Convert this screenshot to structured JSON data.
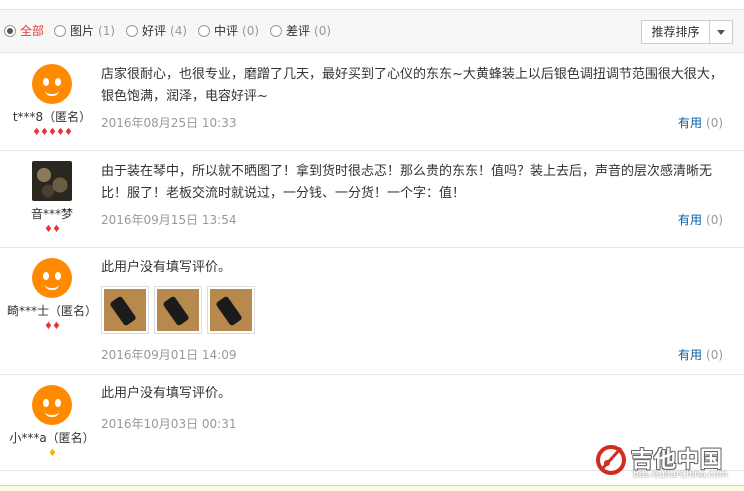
{
  "filters": [
    {
      "label": "全部",
      "count": ""
    },
    {
      "label": "图片",
      "count": "(1)"
    },
    {
      "label": "好评",
      "count": "(4)"
    },
    {
      "label": "中评",
      "count": "(0)"
    },
    {
      "label": "差评",
      "count": "(0)"
    }
  ],
  "active_filter": "全部",
  "sort": {
    "label": "推荐排序"
  },
  "reviews": [
    {
      "user": "t***8（匿名）",
      "content": "店家很耐心，也很专业，磨蹭了几天，最好买到了心仪的东东~大黄蜂装上以后银色调扭调节范围很大很大，银色饱满，润泽，电容好评~",
      "date": "2016年08月25日 10:33",
      "useful_label": "有用",
      "useful_count": "(0)",
      "level_gems": "♦♦♦♦♦"
    },
    {
      "user": "音***梦",
      "content": "由于装在琴中，所以就不晒图了！拿到货时很忐忑！那么贵的东东！值吗？装上去后，声音的层次感清晰无比！服了！老板交流时就说过，一分钱、一分货！一个字：值！",
      "date": "2016年09月15日 13:54",
      "useful_label": "有用",
      "useful_count": "(0)",
      "level_gems": "♦♦"
    },
    {
      "user": "畸***士（匿名）",
      "content": "此用户没有填写评价。",
      "date": "2016年09月01日 14:09",
      "useful_label": "有用",
      "useful_count": "(0)",
      "level_gems": "♦♦"
    },
    {
      "user": "小***a（匿名）",
      "content": "此用户没有填写评价。",
      "date": "2016年10月03日 00:31",
      "level_gems": "♦"
    }
  ],
  "watermark": {
    "name": "吉他中国",
    "url": "bbs.GuitarChina.com"
  },
  "colors": {
    "accent": "#e4393c",
    "link": "#005ea7",
    "avatar": "#ff8a00"
  }
}
